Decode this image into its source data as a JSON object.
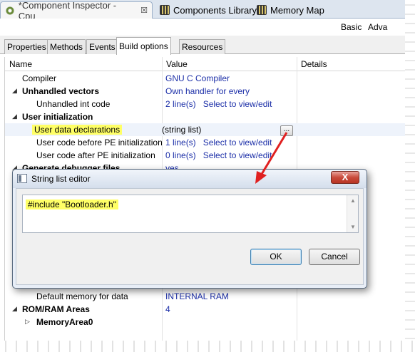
{
  "editor_tabs": [
    {
      "label": "*Component Inspector - Cpu",
      "icon": "gear-icon",
      "close": "☒"
    },
    {
      "label": "Components Library",
      "icon": "chip-icon"
    },
    {
      "label": "Memory Map",
      "icon": "chip-icon"
    }
  ],
  "modes": {
    "basic": "Basic",
    "advanced": "Adva"
  },
  "sub_tabs": [
    "Properties",
    "Methods",
    "Events",
    "Build options",
    "Resources"
  ],
  "table": {
    "columns": [
      "Name",
      "Value",
      "Details"
    ],
    "rows": [
      {
        "name": "Compiler",
        "value": "GNU C Compiler",
        "link": ""
      },
      {
        "name": "Unhandled vectors",
        "value": "Own handler for every",
        "link": ""
      },
      {
        "name": "Unhandled int code",
        "value": "2 line(s)",
        "link": "Select to view/edit"
      },
      {
        "name": "User initialization",
        "value": "",
        "link": ""
      },
      {
        "name": "User data declarations",
        "value": "(string list)",
        "link": ""
      },
      {
        "name": "User code before PE initialization",
        "value": "1 line(s)",
        "link": "Select to view/edit"
      },
      {
        "name": "User code after PE initialization",
        "value": "0 line(s)",
        "link": "Select to view/edit"
      },
      {
        "name": "Generate debugger files",
        "value": "yes",
        "link": ""
      },
      {
        "name": "Default memory for data",
        "value": "INTERNAL RAM",
        "link": ""
      },
      {
        "name": "ROM/RAM Areas",
        "value": "4",
        "link": ""
      },
      {
        "name": "MemoryArea0",
        "value": "",
        "link": ""
      }
    ],
    "ellipsis": "..."
  },
  "dialog": {
    "title": "String list editor",
    "close_glyph": "X",
    "text": "#include \"Bootloader.h\"",
    "ok": "OK",
    "cancel": "Cancel"
  },
  "colors": {
    "highlight": "#ffff66",
    "link": "#1c2fa8",
    "arrow": "#e02020"
  }
}
